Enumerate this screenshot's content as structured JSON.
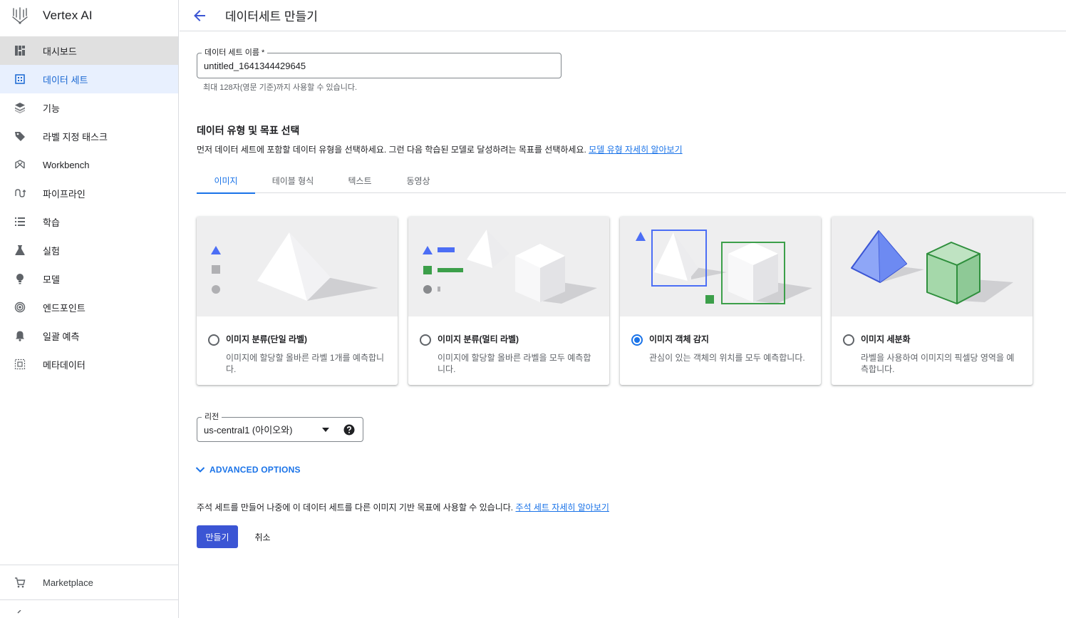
{
  "app": {
    "title": "Vertex AI"
  },
  "sidebar": {
    "items": [
      {
        "label": "대시보드",
        "icon": "dashboard-icon"
      },
      {
        "label": "데이터 세트",
        "icon": "dataset-icon",
        "active": true
      },
      {
        "label": "기능",
        "icon": "features-icon"
      },
      {
        "label": "라벨 지정 태스크",
        "icon": "label-icon"
      },
      {
        "label": "Workbench",
        "icon": "workbench-icon"
      },
      {
        "label": "파이프라인",
        "icon": "pipelines-icon"
      },
      {
        "label": "학습",
        "icon": "training-icon"
      },
      {
        "label": "실험",
        "icon": "experiments-icon"
      },
      {
        "label": "모델",
        "icon": "models-icon"
      },
      {
        "label": "엔드포인트",
        "icon": "endpoints-icon"
      },
      {
        "label": "일괄 예측",
        "icon": "batch-prediction-icon"
      },
      {
        "label": "메타데이터",
        "icon": "metadata-icon"
      }
    ],
    "marketplace_label": "Marketplace"
  },
  "header": {
    "title": "데이터세트 만들기"
  },
  "form": {
    "name_label": "데이터 세트 이름 *",
    "name_value": "untitled_1641344429645",
    "name_hint": "최대 128자(영문 기준)까지 사용할 수 있습니다.",
    "section_title": "데이터 유형 및 목표 선택",
    "section_desc": "먼저 데이터 세트에 포함할 데이터 유형을 선택하세요. 그런 다음 학습된 모델로 달성하려는 목표를 선택하세요.",
    "section_link": "모델 유형 자세히 알아보기",
    "tabs": [
      {
        "label": "이미지",
        "active": true
      },
      {
        "label": "테이블 형식"
      },
      {
        "label": "텍스트"
      },
      {
        "label": "동영상"
      }
    ],
    "cards": [
      {
        "title": "이미지 분류(단일 라벨)",
        "desc": "이미지에 할당할 올바른 라벨 1개를 예측합니다.",
        "selected": false
      },
      {
        "title": "이미지 분류(멀티 라벨)",
        "desc": "이미지에 할당할 올바른 라벨을 모두 예측합니다.",
        "selected": false
      },
      {
        "title": "이미지 객체 감지",
        "desc": "관심이 있는 객체의 위치를 모두 예측합니다.",
        "selected": true
      },
      {
        "title": "이미지 세분화",
        "desc": "라벨을 사용하여 이미지의 픽셀당 영역을 예측합니다.",
        "selected": false
      }
    ],
    "region_label": "리전",
    "region_value": "us-central1 (아이오와)",
    "advanced_label": "ADVANCED OPTIONS",
    "annotation_text": "주석 세트를 만들어 나중에 이 데이터 세트를 다른 이미지 기반 목표에 사용할 수 있습니다.",
    "annotation_link": "주석 세트 자세히 알아보기",
    "create_label": "만들기",
    "cancel_label": "취소"
  },
  "colors": {
    "accent": "#1a73e8",
    "primary_button": "#3b55d4",
    "active_nav_bg": "#e8f0fe"
  }
}
